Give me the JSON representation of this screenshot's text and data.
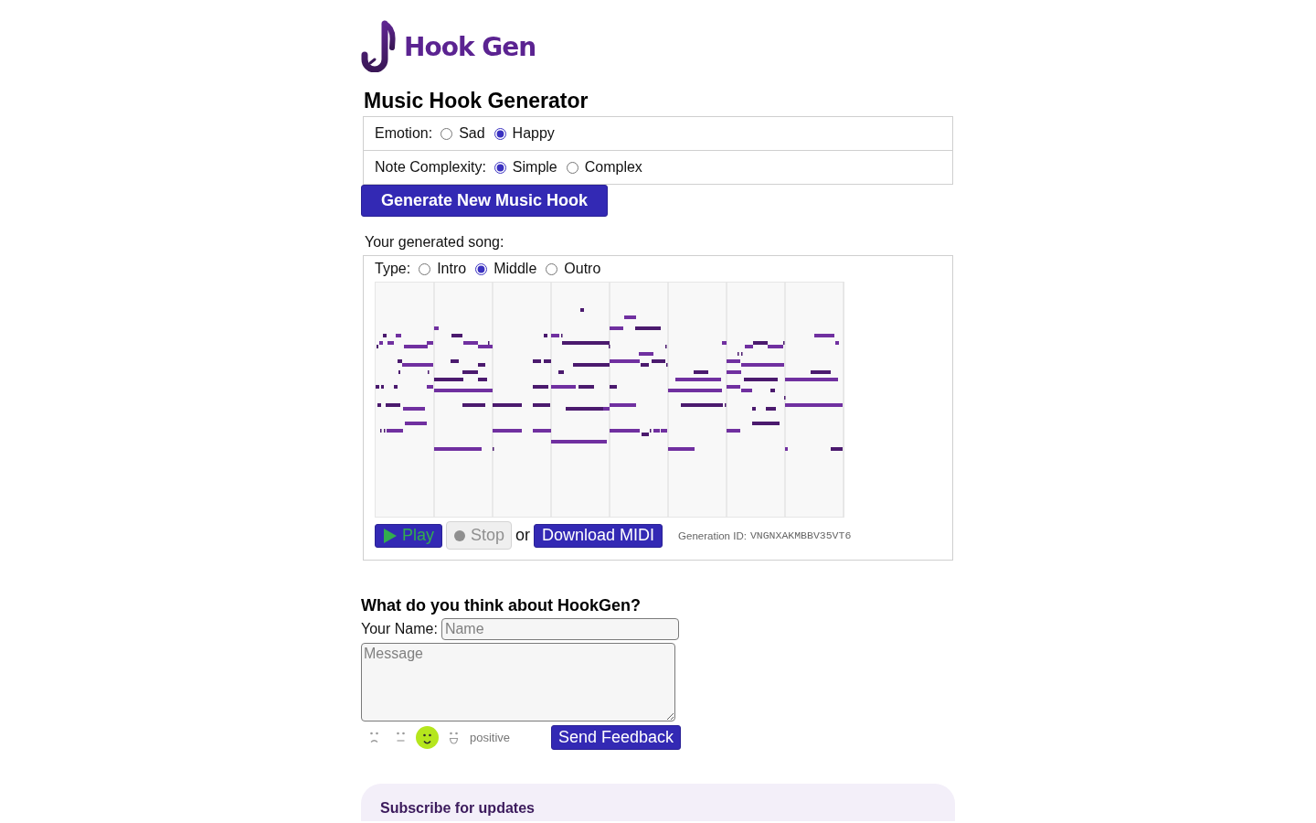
{
  "header": {
    "logo_text": "Hook Gen"
  },
  "title": "Music Hook Generator",
  "options": [
    {
      "label": "Emotion:",
      "choices": [
        {
          "label": "Sad",
          "selected": false
        },
        {
          "label": "Happy",
          "selected": true
        }
      ]
    },
    {
      "label": "Note Complexity:",
      "choices": [
        {
          "label": "Simple",
          "selected": true
        },
        {
          "label": "Complex",
          "selected": false
        }
      ]
    }
  ],
  "generate_button": "Generate New Music Hook",
  "song": {
    "heading": "Your generated song:",
    "type": {
      "label": "Type:",
      "choices": [
        {
          "label": "Intro",
          "selected": false
        },
        {
          "label": "Middle",
          "selected": true
        },
        {
          "label": "Outro",
          "selected": false
        }
      ]
    },
    "player_buttons": [
      {
        "kind": "play",
        "label": "Play",
        "disabled": false
      },
      {
        "kind": "stop",
        "label": "Stop",
        "disabled": true
      }
    ],
    "separator": "or",
    "download_button": "Download MIDI",
    "generation_id": {
      "label": "Generation ID:",
      "value": "VNGNXAKMBBV35VT6"
    }
  },
  "feedback": {
    "heading": "What do you think about HookGen?",
    "name_label": "Your Name:",
    "name_field": {
      "placeholder": "Name"
    },
    "message_field": {
      "placeholder": "Message"
    },
    "rating": {
      "options": [
        {
          "kind": "sad",
          "selected": false
        },
        {
          "kind": "neutral",
          "selected": false
        },
        {
          "kind": "smile",
          "selected": true
        },
        {
          "kind": "grin",
          "selected": false
        }
      ],
      "label": "positive"
    },
    "send_button": "Send Feedback"
  },
  "subscribe": {
    "title": "Subscribe for updates"
  }
}
